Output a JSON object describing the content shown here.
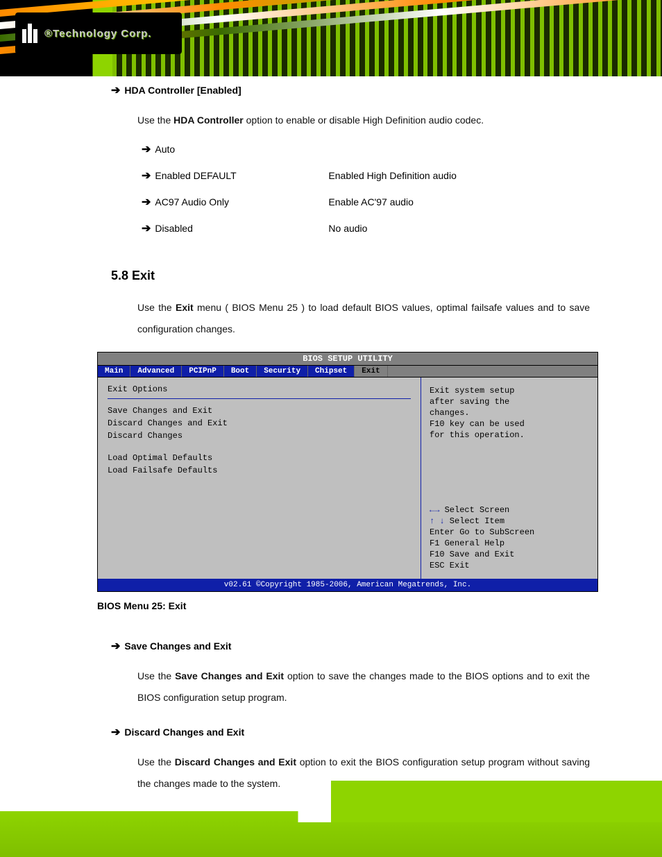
{
  "brand": "®Technology Corp.",
  "section1": {
    "heading": "HDA Controller [Enabled]",
    "intro_pre": "Use the ",
    "intro_bold": "HDA Controller",
    "intro_post": " option to enable or disable High Definition audio codec.",
    "options": [
      {
        "label": "Auto",
        "desc": ""
      },
      {
        "label": "Enabled  DEFAULT",
        "desc": "Enabled High Definition audio"
      },
      {
        "label": "AC97 Audio Only",
        "desc": "Enable AC'97 audio"
      },
      {
        "label": "Disabled",
        "desc": "No audio"
      }
    ]
  },
  "section_exit": {
    "number": "5.8 Exit",
    "intro_pre": "Use the ",
    "intro_bold": "Exit",
    "intro_mid": " menu (",
    "intro_ref": "BIOS Menu 25",
    "intro_post": ") to load default BIOS values, optimal failsafe values and to save configuration changes."
  },
  "bios": {
    "title": "BIOS SETUP UTILITY",
    "tabs": [
      "Main",
      "Advanced",
      "PCIPnP",
      "Boot",
      "Security",
      "Chipset",
      "Exit"
    ],
    "active_tab": "Exit",
    "group": "Exit Options",
    "items": [
      "Save Changes and Exit",
      "Discard Changes and Exit",
      "Discard Changes",
      "Load Optimal Defaults",
      "Load Failsafe Defaults"
    ],
    "help_top": [
      "Exit system setup",
      "after saving the",
      "changes.",
      "",
      "F10 key can be used",
      "for this operation."
    ],
    "help_keys": [
      {
        "k": "←→",
        "t": "   Select Screen"
      },
      {
        "k": "↑ ↓",
        "t": "   Select Item"
      },
      {
        "k": "Enter",
        "t": " Go to SubScreen"
      },
      {
        "k": "F1",
        "t": "    General Help"
      },
      {
        "k": "F10",
        "t": "   Save and Exit"
      },
      {
        "k": "ESC",
        "t": "   Exit"
      }
    ],
    "footer": "v02.61 ©Copyright 1985-2006, American Megatrends, Inc.",
    "caption": "BIOS Menu 25: Exit"
  },
  "save_exit": {
    "heading": "Save Changes and Exit",
    "pre": "Use the ",
    "bold": "Save Changes and Exit",
    "post": " option to save the changes made to the BIOS options and to exit the BIOS configuration setup program."
  },
  "discard_exit": {
    "heading": "Discard Changes and Exit",
    "pre": "Use the ",
    "bold": "Discard Changes and Exit",
    "post": " option to exit the BIOS configuration setup program without saving the changes made to the system."
  }
}
